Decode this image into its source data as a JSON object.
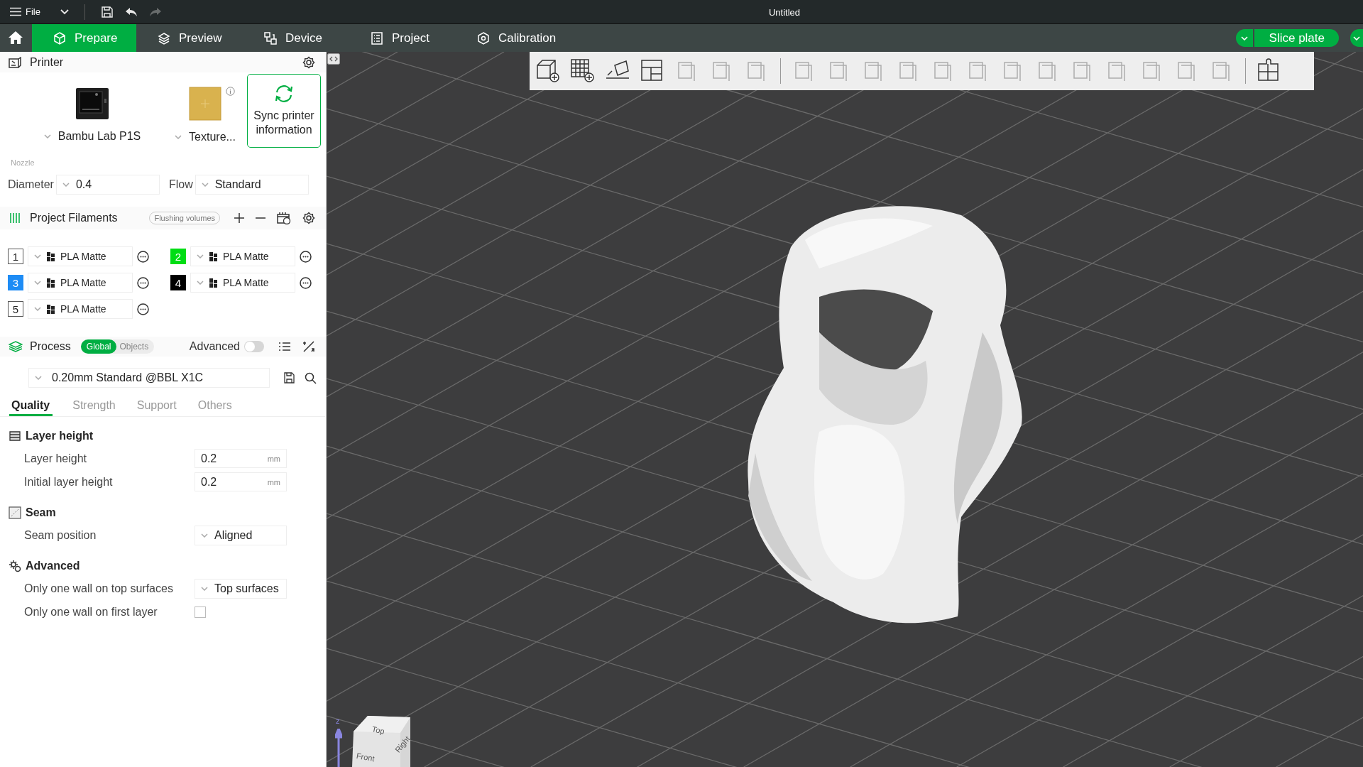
{
  "menu_bar": {
    "file_label": "File",
    "title": "Untitled",
    "undo_disabled": false,
    "redo_disabled": true
  },
  "nav_tabs": [
    {
      "label": "Prepare",
      "selected": true
    },
    {
      "label": "Preview",
      "selected": false
    },
    {
      "label": "Device",
      "selected": false
    },
    {
      "label": "Project",
      "selected": false
    },
    {
      "label": "Calibration",
      "selected": false
    }
  ],
  "slice_button": {
    "label": "Slice plate"
  },
  "printer": {
    "title": "Printer",
    "printer_name": "Bambu Lab P1S",
    "plate_name": "Texture...",
    "sync_label": "Sync printer information",
    "nozzle_label": "Nozzle",
    "diameter_label": "Diameter",
    "diameter_value": "0.4",
    "flow_label": "Flow",
    "flow_value": "Standard"
  },
  "filaments": {
    "title": "Project Filaments",
    "flushing_label": "Flushing volumes",
    "items": [
      {
        "number": "1",
        "name": "PLA Matte",
        "color": "#ffffff"
      },
      {
        "number": "2",
        "name": "PLA Matte",
        "color": "#00dd14"
      },
      {
        "number": "3",
        "name": "PLA Matte",
        "color": "#1e8cf5"
      },
      {
        "number": "4",
        "name": "PLA Matte",
        "color": "#000000"
      },
      {
        "number": "5",
        "name": "PLA Matte",
        "color": "#ffffff"
      }
    ]
  },
  "process": {
    "title": "Process",
    "scopes": [
      {
        "label": "Global",
        "selected": true
      },
      {
        "label": "Objects",
        "selected": false
      }
    ],
    "advanced_label": "Advanced",
    "advanced_on": false,
    "preset": "0.20mm Standard @BBL X1C",
    "tabs": [
      {
        "label": "Quality",
        "selected": true
      },
      {
        "label": "Strength",
        "selected": false
      },
      {
        "label": "Support",
        "selected": false
      },
      {
        "label": "Others",
        "selected": false
      }
    ],
    "groups": [
      {
        "title": "Layer height",
        "options": [
          {
            "kind": "number",
            "label": "Layer height",
            "value": "0.2",
            "unit": "mm"
          },
          {
            "kind": "number",
            "label": "Initial layer height",
            "value": "0.2",
            "unit": "mm"
          }
        ]
      },
      {
        "title": "Seam",
        "options": [
          {
            "kind": "select",
            "label": "Seam position",
            "value": "Aligned"
          }
        ]
      },
      {
        "title": "Advanced",
        "options": [
          {
            "kind": "select",
            "label": "Only one wall on top surfaces",
            "value": "Top surfaces"
          },
          {
            "kind": "checkbox",
            "label": "Only one wall on first layer",
            "checked": false
          }
        ]
      }
    ]
  },
  "viewport": {
    "toolbar_groups": [
      {
        "tools": [
          {
            "disabled": false
          },
          {
            "disabled": false
          },
          {
            "disabled": false
          },
          {
            "disabled": false
          },
          {
            "disabled": true
          },
          {
            "disabled": true
          },
          {
            "disabled": true
          }
        ]
      },
      {
        "tools": [
          {
            "disabled": true
          },
          {
            "disabled": true
          },
          {
            "disabled": true
          },
          {
            "disabled": true
          },
          {
            "disabled": true
          },
          {
            "disabled": true
          },
          {
            "disabled": true
          },
          {
            "disabled": true
          },
          {
            "disabled": true
          },
          {
            "disabled": true
          },
          {
            "disabled": true
          },
          {
            "disabled": true
          },
          {
            "disabled": true
          }
        ]
      },
      {
        "tools": [
          {
            "disabled": false
          }
        ]
      }
    ],
    "view_cube": {
      "axis_label": "z",
      "faces": [
        "Top",
        "Front",
        "Right"
      ]
    }
  }
}
